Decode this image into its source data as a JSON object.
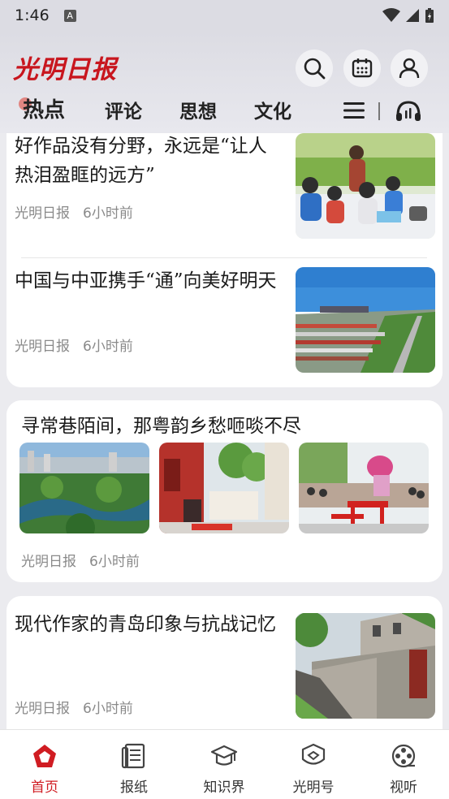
{
  "status_bar": {
    "time": "1:46",
    "notification_icon": "A"
  },
  "header": {
    "logo": "光明日报",
    "icons": [
      "search-icon",
      "calendar-icon",
      "profile-icon"
    ]
  },
  "tabs": [
    {
      "label": "热点",
      "active": true
    },
    {
      "label": "评论",
      "active": false
    },
    {
      "label": "思想",
      "active": false
    },
    {
      "label": "文化",
      "active": false
    }
  ],
  "feed": {
    "card1": {
      "items": [
        {
          "title": "好作品没有分野，永远是“让人热泪盈眶的远方”",
          "source": "光明日报",
          "time": "6小时前"
        },
        {
          "title": "中国与中亚携手“通”向美好明天",
          "source": "光明日报",
          "time": "6小时前"
        }
      ]
    },
    "card2": {
      "title": "寻常巷陌间，那粤韵乡愁咂啖不尽",
      "source": "光明日报",
      "time": "6小时前"
    },
    "card3": {
      "title": "现代作家的青岛印象与抗战记忆",
      "source": "光明日报",
      "time": "6小时前"
    }
  },
  "bottom_nav": [
    {
      "label": "首页",
      "icon": "home-icon",
      "active": true
    },
    {
      "label": "报纸",
      "icon": "newspaper-icon",
      "active": false
    },
    {
      "label": "知识界",
      "icon": "graduation-cap-icon",
      "active": false
    },
    {
      "label": "光明号",
      "icon": "badge-icon",
      "active": false
    },
    {
      "label": "视听",
      "icon": "film-reel-icon",
      "active": false
    }
  ],
  "colors": {
    "brand": "#c8161e",
    "active_nav": "#d01c22",
    "meta_text": "#8a8a8a"
  }
}
